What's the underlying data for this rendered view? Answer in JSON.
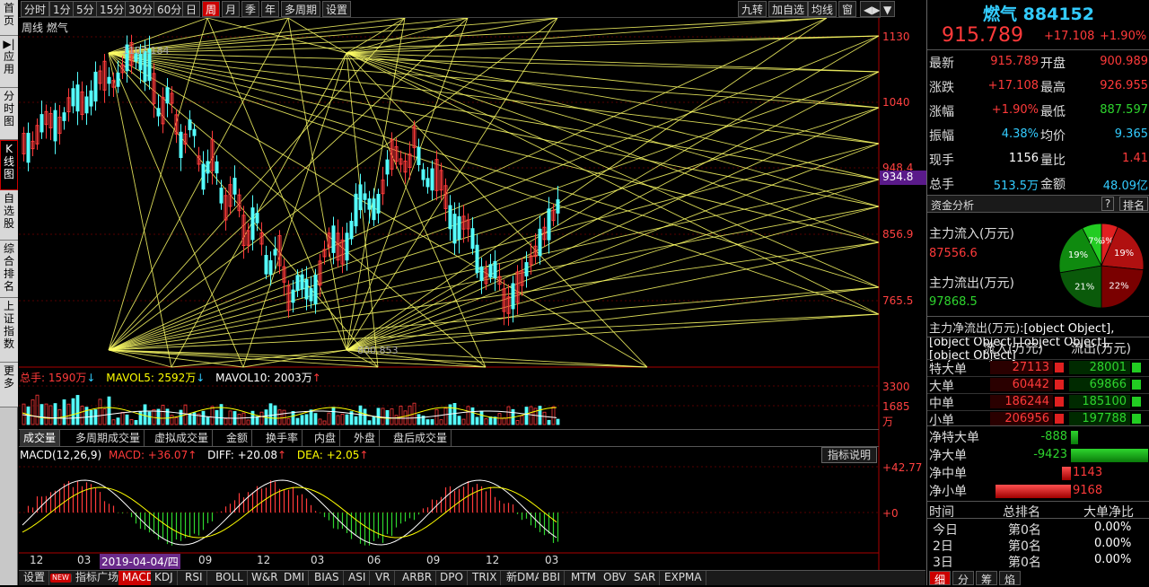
{
  "nav": {
    "items": [
      "首\n页",
      "▶|\n应\n用",
      "分\n时\n图",
      "K\n线\n图",
      "自\n选\n股",
      "综\n合\n排\n名",
      "上\n证\n指\n数",
      "更\n多"
    ]
  },
  "periods": {
    "items": [
      "分时",
      "1分",
      "5分",
      "15分",
      "30分",
      "60分",
      "日",
      "周",
      "月",
      "季",
      "年",
      "多周期",
      "设置"
    ],
    "active": "周"
  },
  "toolbar_right": {
    "items": [
      "九转",
      "加自选",
      "均线",
      "窗",
      "◀▶",
      "▼"
    ]
  },
  "chart": {
    "label": "周线  燃气",
    "high_label": "1107.184",
    "low_label": "800.853",
    "price_ticks": [
      "1130",
      "1040",
      "948.4",
      "856.9",
      "765.5"
    ],
    "current_price_tag": "934.8",
    "vol_ticks": [
      "3300",
      "1685",
      "万"
    ],
    "macd_ticks": [
      "+42.77",
      "+0"
    ],
    "x_ticks": [
      "12",
      "03",
      "2019-04-04/四",
      "09",
      "12",
      "03",
      "06",
      "09",
      "12",
      "03"
    ]
  },
  "volume_legend": {
    "zong": "总手: 1590万",
    "ma5": "MAVOL5: 2592万",
    "ma10": "MAVOL10: 2003万"
  },
  "mid_tabs": {
    "items": [
      "成交量",
      "多周期成交量",
      "虚拟成交量",
      "金额",
      "换手率",
      "内盘",
      "外盘",
      "盘后成交量"
    ],
    "active": "成交量"
  },
  "macd_legend": {
    "name": "MACD(12,26,9)",
    "macd": "MACD: +36.07",
    "diff": "DIFF: +20.08",
    "dea": "DEA: +2.05",
    "explain": "指标说明"
  },
  "bottom_tabs": {
    "items": [
      "设置",
      "NEW",
      "指标广场",
      "MACD",
      "KDJ",
      "RSI",
      "BOLL",
      "W&R",
      "DMI",
      "BIAS",
      "ASI",
      "VR",
      "ARBR",
      "DPO",
      "TRIX",
      "新DMA",
      "BBI",
      "MTM",
      "OBV",
      "SAR",
      "EXPMA"
    ],
    "active": "MACD"
  },
  "quote": {
    "name": "燃气",
    "code": "884152",
    "price": "915.789",
    "change": "+17.108",
    "pct": "+1.90%",
    "rows": [
      {
        "l1": "最新",
        "v1": "915.789",
        "c1": "red",
        "l2": "开盘",
        "v2": "900.989",
        "c2": "red"
      },
      {
        "l1": "涨跌",
        "v1": "+17.108",
        "c1": "red",
        "l2": "最高",
        "v2": "926.955",
        "c2": "red"
      },
      {
        "l1": "涨幅",
        "v1": "+1.90%",
        "c1": "red",
        "l2": "最低",
        "v2": "887.597",
        "c2": "grn"
      },
      {
        "l1": "振幅",
        "v1": "4.38%",
        "c1": "cyn",
        "l2": "均价",
        "v2": "9.365",
        "c2": "cyn"
      },
      {
        "l1": "现手",
        "v1": "1156",
        "c1": "wht",
        "l2": "量比",
        "v2": "1.41",
        "c2": "red"
      },
      {
        "l1": "总手",
        "v1": "513.5万",
        "c1": "cyn",
        "l2": "金额",
        "v2": "48.09亿",
        "c2": "cyn"
      }
    ]
  },
  "funds": {
    "title": "资金分析",
    "help": "?",
    "rank": "排名",
    "inflow_label": "主力流入(万元)",
    "inflow": "87556.6",
    "outflow_label": "主力流出(万元)",
    "outflow": "97868.5",
    "net_label": "主力净流出(万元):",
    "net": [
      {
        "name": "净特大单",
        "value": "-888",
        "num": -888
      },
      {
        "name": "净大单",
        "value": "-9423",
        "num": -9423
      },
      {
        "name": "净中单",
        "value": "1143",
        "num": 1143
      },
      {
        "name": "净小单",
        "value": "9168",
        "num": 9168
      }
    ],
    "pie": [
      {
        "pct": "6%",
        "value": 6,
        "color": "#e02020"
      },
      {
        "pct": "19%",
        "value": 19,
        "color": "#b01010"
      },
      {
        "pct": "22%",
        "value": 22,
        "color": "#7a0000"
      },
      {
        "pct": "21%",
        "value": 21,
        "color": "#0a5a0a"
      },
      {
        "pct": "19%",
        "value": 19,
        "color": "#0f8a0f"
      },
      {
        "pct": "7%",
        "value": 7,
        "color": "#22cc22"
      }
    ],
    "table_head": {
      "in": "流入(万元)",
      "out": "流出(万元)"
    },
    "table": [
      {
        "name": "特大单",
        "in": "27113",
        "out": "28001"
      },
      {
        "name": "大单",
        "in": "60442",
        "out": "69866"
      },
      {
        "name": "中单",
        "in": "186244",
        "out": "185100"
      },
      {
        "name": "小单",
        "in": "206956",
        "out": "197788"
      }
    ],
    "rank_head": {
      "time": "时间",
      "total": "总排名",
      "ratio": "大单净比"
    },
    "rank_rows": [
      {
        "t": "今日",
        "r": "第0名",
        "p": "0.00%"
      },
      {
        "t": "2日",
        "r": "第0名",
        "p": "0.00%"
      },
      {
        "t": "3日",
        "r": "第0名",
        "p": "0.00%"
      }
    ],
    "bottom_tabs": [
      "细",
      "分",
      "筹",
      "焰"
    ]
  },
  "colors": {
    "up": "#ff3a3a",
    "down": "#54ffff",
    "gann": "#ffff66"
  }
}
